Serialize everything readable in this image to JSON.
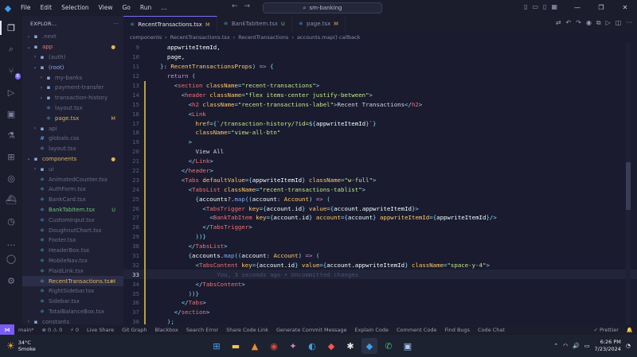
{
  "titlebar": {
    "menu": [
      "File",
      "Edit",
      "Selection",
      "View",
      "Go",
      "Run",
      "…"
    ],
    "search_text": "sm-banking"
  },
  "sidebar": {
    "title": "EXPLOR...",
    "tree": [
      {
        "label": ".next",
        "kind": "folder",
        "depth": 1,
        "chev": "›",
        "icon": "▪",
        "cls": "c-dim"
      },
      {
        "label": "app",
        "kind": "folder",
        "depth": 1,
        "chev": "⌄",
        "icon": "▪",
        "cls": "c-app",
        "status": "●",
        "status_cls": "c-mod"
      },
      {
        "label": "(auth)",
        "kind": "folder",
        "depth": 2,
        "chev": "›",
        "icon": "▪",
        "cls": "c-dim"
      },
      {
        "label": "(root)",
        "kind": "folder",
        "depth": 2,
        "chev": "⌄",
        "icon": "▪",
        "cls": "c-folder"
      },
      {
        "label": "my-banks",
        "kind": "folder",
        "depth": 3,
        "chev": "›",
        "icon": "▪",
        "cls": "c-dim"
      },
      {
        "label": "payment-transfer",
        "kind": "folder",
        "depth": 3,
        "chev": "›",
        "icon": "▪",
        "cls": "c-dim"
      },
      {
        "label": "transaction-history",
        "kind": "folder",
        "depth": 3,
        "chev": "›",
        "icon": "▪",
        "cls": "c-dim"
      },
      {
        "label": "layout.tsx",
        "kind": "file",
        "depth": 3,
        "chev": "",
        "icon": "⚛",
        "cls": "c-dim"
      },
      {
        "label": "page.tsx",
        "kind": "file",
        "depth": 3,
        "chev": "",
        "icon": "⚛",
        "cls": "c-mod",
        "status": "M",
        "status_cls": "c-mod"
      },
      {
        "label": "api",
        "kind": "folder",
        "depth": 2,
        "chev": "›",
        "icon": "▪",
        "cls": "c-dim"
      },
      {
        "label": "globals.css",
        "kind": "file",
        "depth": 2,
        "chev": "",
        "icon": "#",
        "cls": "c-dim"
      },
      {
        "label": "layout.tsx",
        "kind": "file",
        "depth": 2,
        "chev": "",
        "icon": "⚛",
        "cls": "c-dim"
      },
      {
        "label": "components",
        "kind": "folder",
        "depth": 1,
        "chev": "⌄",
        "icon": "▪",
        "cls": "c-mod",
        "status": "●",
        "status_cls": "c-mod"
      },
      {
        "label": "ui",
        "kind": "folder",
        "depth": 2,
        "chev": "›",
        "icon": "▪",
        "cls": "c-dim"
      },
      {
        "label": "AnimatedCounter.tsx",
        "kind": "file",
        "depth": 2,
        "chev": "",
        "icon": "⚛",
        "cls": "c-dim"
      },
      {
        "label": "AuthForm.tsx",
        "kind": "file",
        "depth": 2,
        "chev": "",
        "icon": "⚛",
        "cls": "c-dim"
      },
      {
        "label": "BankCard.tsx",
        "kind": "file",
        "depth": 2,
        "chev": "",
        "icon": "⚛",
        "cls": "c-dim"
      },
      {
        "label": "BankTabItem.tsx",
        "kind": "file",
        "depth": 2,
        "chev": "",
        "icon": "⚛",
        "cls": "c-new",
        "status": "U",
        "status_cls": "c-new"
      },
      {
        "label": "CustomInput.tsx",
        "kind": "file",
        "depth": 2,
        "chev": "",
        "icon": "⚛",
        "cls": "c-dim"
      },
      {
        "label": "DoughnutChart.tsx",
        "kind": "file",
        "depth": 2,
        "chev": "",
        "icon": "⚛",
        "cls": "c-dim"
      },
      {
        "label": "Footer.tsx",
        "kind": "file",
        "depth": 2,
        "chev": "",
        "icon": "⚛",
        "cls": "c-dim"
      },
      {
        "label": "HeaderBox.tsx",
        "kind": "file",
        "depth": 2,
        "chev": "",
        "icon": "⚛",
        "cls": "c-dim"
      },
      {
        "label": "MobileNav.tsx",
        "kind": "file",
        "depth": 2,
        "chev": "",
        "icon": "⚛",
        "cls": "c-dim"
      },
      {
        "label": "PlaidLink.tsx",
        "kind": "file",
        "depth": 2,
        "chev": "",
        "icon": "⚛",
        "cls": "c-dim"
      },
      {
        "label": "RecentTransactions.tsx",
        "kind": "file",
        "depth": 2,
        "chev": "",
        "icon": "⚛",
        "cls": "c-mod",
        "status": "M",
        "status_cls": "c-mod",
        "selected": true
      },
      {
        "label": "RightSidebar.tsx",
        "kind": "file",
        "depth": 2,
        "chev": "",
        "icon": "⚛",
        "cls": "c-dim"
      },
      {
        "label": "Sidebar.tsx",
        "kind": "file",
        "depth": 2,
        "chev": "",
        "icon": "⚛",
        "cls": "c-dim"
      },
      {
        "label": "TotalBalanceBox.tsx",
        "kind": "file",
        "depth": 2,
        "chev": "",
        "icon": "⚛",
        "cls": "c-dim"
      },
      {
        "label": "constants",
        "kind": "folder",
        "depth": 1,
        "chev": "›",
        "icon": "▪",
        "cls": "c-dim"
      }
    ]
  },
  "tabs": [
    {
      "label": "RecentTransactions.tsx",
      "status": "M",
      "active": true,
      "status_cls": "c-mod"
    },
    {
      "label": "BankTabItem.tsx",
      "status": "U",
      "active": false,
      "status_cls": "c-new"
    },
    {
      "label": "page.tsx",
      "status": "M",
      "active": false,
      "status_cls": "c-mod"
    }
  ],
  "breadcrumbs": [
    "components",
    "RecentTransactions.tsx",
    "RecentTransactions",
    "accounts.map() callback"
  ],
  "code": {
    "current_line": 33,
    "blame": "You, 3 seconds ago • Uncommitted changes",
    "lines": [
      {
        "n": 9,
        "tokens": [
          [
            "t-var",
            "  appwriteItemId,"
          ]
        ]
      },
      {
        "n": 10,
        "tokens": [
          [
            "t-var",
            "  page,"
          ]
        ]
      },
      {
        "n": 11,
        "tokens": [
          [
            "t-br",
            "}"
          ],
          [
            "t-txt",
            ": "
          ],
          [
            "t-ty",
            "RecentTransactionsProps"
          ],
          [
            "t-br",
            ")"
          ],
          [
            "t-kw",
            " => "
          ],
          [
            "t-br",
            "{"
          ]
        ]
      },
      {
        "n": 12,
        "tokens": [
          [
            "t-kw",
            "  return "
          ],
          [
            "t-br",
            "("
          ]
        ]
      },
      {
        "n": 13,
        "tokens": [
          [
            "t-br",
            "    <"
          ],
          [
            "t-tag",
            "section"
          ],
          [
            "t-attr",
            " className"
          ],
          [
            "t-br",
            "="
          ],
          [
            "t-str",
            "\"recent-transactions\""
          ],
          [
            "t-br",
            ">"
          ]
        ]
      },
      {
        "n": 14,
        "tokens": [
          [
            "t-br",
            "      <"
          ],
          [
            "t-tag",
            "header"
          ],
          [
            "t-attr",
            " className"
          ],
          [
            "t-br",
            "="
          ],
          [
            "t-str",
            "\"flex items-center justify-between\""
          ],
          [
            "t-br",
            ">"
          ]
        ]
      },
      {
        "n": 15,
        "tokens": [
          [
            "t-br",
            "        <"
          ],
          [
            "t-tag",
            "h2"
          ],
          [
            "t-attr",
            " className"
          ],
          [
            "t-br",
            "="
          ],
          [
            "t-str",
            "\"recent-transactions-label\""
          ],
          [
            "t-br",
            ">"
          ],
          [
            "t-txt",
            "Recent Transactions"
          ],
          [
            "t-br",
            "</"
          ],
          [
            "t-tag",
            "h2"
          ],
          [
            "t-br",
            ">"
          ]
        ]
      },
      {
        "n": 16,
        "tokens": [
          [
            "t-br",
            "        <"
          ],
          [
            "t-tag",
            "Link"
          ]
        ]
      },
      {
        "n": 17,
        "tokens": [
          [
            "t-attr",
            "          href"
          ],
          [
            "t-br",
            "={"
          ],
          [
            "t-str",
            "`/transaction-history/?id="
          ],
          [
            "t-br",
            "${"
          ],
          [
            "t-var",
            "appwriteItemId"
          ],
          [
            "t-br",
            "}"
          ],
          [
            "t-str",
            "`"
          ],
          [
            "t-br",
            "}"
          ]
        ]
      },
      {
        "n": 18,
        "tokens": [
          [
            "t-attr",
            "          className"
          ],
          [
            "t-br",
            "="
          ],
          [
            "t-str",
            "\"view-all-btn\""
          ]
        ]
      },
      {
        "n": 19,
        "tokens": [
          [
            "t-br",
            "        >"
          ]
        ]
      },
      {
        "n": 20,
        "tokens": [
          [
            "t-txt",
            "          View All"
          ]
        ]
      },
      {
        "n": 21,
        "tokens": [
          [
            "t-br",
            "        </"
          ],
          [
            "t-tag",
            "Link"
          ],
          [
            "t-br",
            ">"
          ]
        ]
      },
      {
        "n": 22,
        "tokens": [
          [
            "t-br",
            "      </"
          ],
          [
            "t-tag",
            "header"
          ],
          [
            "t-br",
            ">"
          ]
        ]
      },
      {
        "n": 23,
        "tokens": [
          [
            "t-br",
            "      <"
          ],
          [
            "t-tag",
            "Tabs"
          ],
          [
            "t-attr",
            " defaultValue"
          ],
          [
            "t-br",
            "={"
          ],
          [
            "t-var",
            "appwriteItemId"
          ],
          [
            "t-br",
            "}"
          ],
          [
            "t-attr",
            " className"
          ],
          [
            "t-br",
            "="
          ],
          [
            "t-str",
            "\"w-full\""
          ],
          [
            "t-br",
            ">"
          ]
        ]
      },
      {
        "n": 24,
        "tokens": [
          [
            "t-br",
            "        <"
          ],
          [
            "t-tag",
            "TabsList"
          ],
          [
            "t-attr",
            " className"
          ],
          [
            "t-br",
            "="
          ],
          [
            "t-str",
            "\"recent-transactions-tablist\""
          ],
          [
            "t-br",
            ">"
          ]
        ]
      },
      {
        "n": 25,
        "tokens": [
          [
            "t-br",
            "          {"
          ],
          [
            "t-var",
            "accounts"
          ],
          [
            "t-txt",
            "?."
          ],
          [
            "t-fn",
            "map"
          ],
          [
            "t-br",
            "(("
          ],
          [
            "t-var",
            "account"
          ],
          [
            "t-txt",
            ": "
          ],
          [
            "t-ty",
            "Account"
          ],
          [
            "t-br",
            ")"
          ],
          [
            "t-kw",
            " => "
          ],
          [
            "t-br",
            "("
          ]
        ]
      },
      {
        "n": 26,
        "tokens": [
          [
            "t-br",
            "            <"
          ],
          [
            "t-tag",
            "TabsTrigger"
          ],
          [
            "t-attr",
            " key"
          ],
          [
            "t-br",
            "={"
          ],
          [
            "t-var",
            "account.id"
          ],
          [
            "t-br",
            "}"
          ],
          [
            "t-attr",
            " value"
          ],
          [
            "t-br",
            "={"
          ],
          [
            "t-var",
            "account.appwriteItemId"
          ],
          [
            "t-br",
            "}>"
          ]
        ]
      },
      {
        "n": 27,
        "tokens": [
          [
            "t-br",
            "              <"
          ],
          [
            "t-tag",
            "BankTabItem"
          ],
          [
            "t-attr",
            " key"
          ],
          [
            "t-br",
            "={"
          ],
          [
            "t-var",
            "account.id"
          ],
          [
            "t-br",
            "}"
          ],
          [
            "t-attr",
            " account"
          ],
          [
            "t-br",
            "={"
          ],
          [
            "t-var",
            "account"
          ],
          [
            "t-br",
            "}"
          ],
          [
            "t-attr",
            " appwriteItemId"
          ],
          [
            "t-br",
            "={"
          ],
          [
            "t-var",
            "appwriteItemId"
          ],
          [
            "t-br",
            "}/>"
          ]
        ]
      },
      {
        "n": 28,
        "tokens": [
          [
            "t-br",
            "            </"
          ],
          [
            "t-tag",
            "TabsTrigger"
          ],
          [
            "t-br",
            ">"
          ]
        ]
      },
      {
        "n": 29,
        "tokens": [
          [
            "t-br",
            "          ))}"
          ]
        ]
      },
      {
        "n": 30,
        "tokens": [
          [
            "t-br",
            "        </"
          ],
          [
            "t-tag",
            "TabsList"
          ],
          [
            "t-br",
            ">"
          ]
        ]
      },
      {
        "n": 31,
        "tokens": [
          [
            "t-br",
            "        {"
          ],
          [
            "t-var",
            "accounts"
          ],
          [
            "t-txt",
            "."
          ],
          [
            "t-fn",
            "map"
          ],
          [
            "t-br",
            "(("
          ],
          [
            "t-var",
            "account"
          ],
          [
            "t-txt",
            ": "
          ],
          [
            "t-ty",
            "Account"
          ],
          [
            "t-br",
            ")"
          ],
          [
            "t-kw",
            " => "
          ],
          [
            "t-br",
            "("
          ]
        ]
      },
      {
        "n": 32,
        "tokens": [
          [
            "t-br",
            "          <"
          ],
          [
            "t-tag",
            "TabsContent"
          ],
          [
            "t-attr",
            " key"
          ],
          [
            "t-br",
            "={"
          ],
          [
            "t-var",
            "account.id"
          ],
          [
            "t-br",
            "}"
          ],
          [
            "t-attr",
            " value"
          ],
          [
            "t-br",
            "={"
          ],
          [
            "t-var",
            "account.appwriteItemId"
          ],
          [
            "t-br",
            "}"
          ],
          [
            "t-attr",
            " className"
          ],
          [
            "t-br",
            "="
          ],
          [
            "t-str",
            "\"space-y-4\""
          ],
          [
            "t-br",
            ">"
          ]
        ]
      },
      {
        "n": 33,
        "tokens": [
          [
            "t-txt",
            "            "
          ]
        ],
        "blame": true
      },
      {
        "n": 34,
        "tokens": [
          [
            "t-br",
            "          </"
          ],
          [
            "t-tag",
            "TabsContent"
          ],
          [
            "t-br",
            ">"
          ]
        ]
      },
      {
        "n": 35,
        "tokens": [
          [
            "t-br",
            "        ))}"
          ]
        ]
      },
      {
        "n": 36,
        "tokens": [
          [
            "t-br",
            "      </"
          ],
          [
            "t-tag",
            "Tabs"
          ],
          [
            "t-br",
            ">"
          ]
        ]
      },
      {
        "n": 37,
        "tokens": [
          [
            "t-br",
            "    </"
          ],
          [
            "t-tag",
            "section"
          ],
          [
            "t-br",
            ">"
          ]
        ]
      },
      {
        "n": 38,
        "tokens": [
          [
            "t-br",
            "  );"
          ]
        ]
      },
      {
        "n": 39,
        "tokens": [
          [
            "t-br",
            "};"
          ]
        ]
      }
    ]
  },
  "statusbar": {
    "left": [
      "main*",
      "⊗ 0 ⚠ 0",
      "⚡ 0",
      "Live Share",
      "Git Graph",
      "Blackbox",
      "Search Error",
      "Share Code Link",
      "Generate Commit Message",
      "Explain Code",
      "Comment Code",
      "Find Bugs",
      "Code Chat"
    ],
    "right": [
      "✓ Prettier"
    ]
  },
  "taskbar": {
    "temperature": "34°C",
    "weather_text": "Smoke",
    "time": "6:26 PM",
    "date": "7/23/2024"
  }
}
